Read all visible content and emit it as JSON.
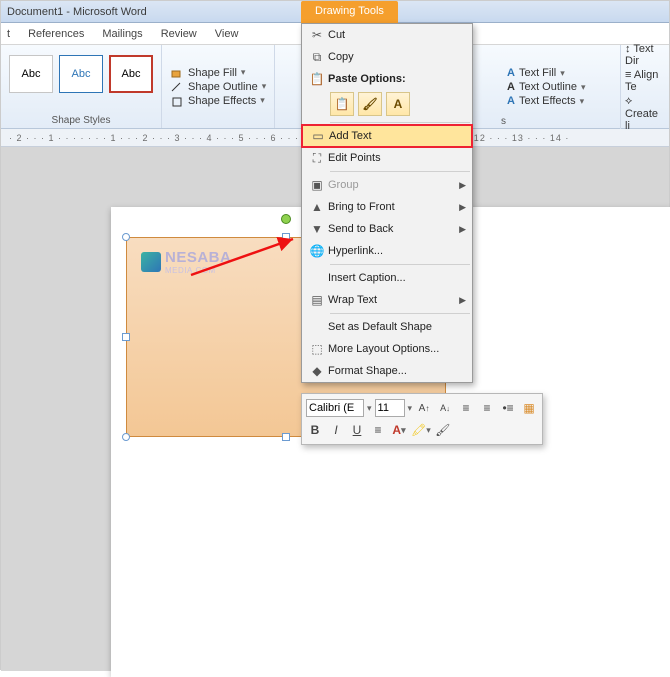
{
  "window": {
    "title": "Document1  -  Microsoft Word",
    "tool_tab": "Drawing Tools"
  },
  "tabs": {
    "t1": "t",
    "references": "References",
    "mailings": "Mailings",
    "review": "Review",
    "view": "View"
  },
  "ribbon": {
    "swatch_text": "Abc",
    "shape_styles_label": "Shape Styles",
    "shape_fill": "Shape Fill",
    "shape_outline": "Shape Outline",
    "shape_effects": "Shape Effects",
    "text_fill": "Text Fill",
    "text_outline": "Text Outline",
    "text_effects": "Text Effects",
    "s_label": "s",
    "text_dir": "Text Dir",
    "align_te": "Align Te",
    "create_li": "Create li"
  },
  "ruler_text": "· 2 · · · 1 · · · · · · · 1 · · · 2 · · · 3 · · · 4 · · · 5 · · · 6 · · · 7 · · · 8 · · · 9 · · · 10 · · · 11 · · · 12 · · · 13 · · · 14 ·",
  "watermark": {
    "text": "NESABA",
    "sub": "MEDIA.COM"
  },
  "context_menu": {
    "cut": "Cut",
    "copy": "Copy",
    "paste_options": "Paste Options:",
    "add_text": "Add Text",
    "edit_points": "Edit Points",
    "group": "Group",
    "bring_front": "Bring to Front",
    "send_back": "Send to Back",
    "hyperlink": "Hyperlink...",
    "insert_caption": "Insert Caption...",
    "wrap_text": "Wrap Text",
    "set_default": "Set as Default Shape",
    "more_layout": "More Layout Options...",
    "format_shape": "Format Shape...",
    "paste_A": "A"
  },
  "mini_toolbar": {
    "font": "Calibri (E",
    "size": "11",
    "b": "B",
    "i": "I",
    "u": "U"
  }
}
